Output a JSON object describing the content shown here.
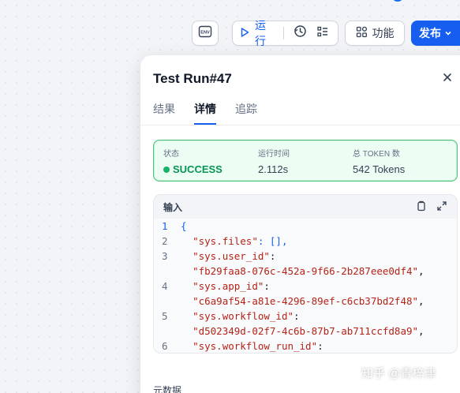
{
  "toolbar": {
    "env_label": "ENV",
    "run_label": "运行",
    "features_label": "功能",
    "publish_label": "发布"
  },
  "panel": {
    "title": "Test Run#47",
    "tabs": [
      {
        "label": "结果",
        "active": false
      },
      {
        "label": "详情",
        "active": true
      },
      {
        "label": "追踪",
        "active": false
      }
    ],
    "status": {
      "status_label": "状态",
      "status_value": "SUCCESS",
      "time_label": "运行时间",
      "time_value": "2.112s",
      "tokens_label": "总 TOKEN 数",
      "tokens_value": "542 Tokens"
    },
    "input": {
      "title": "输入",
      "lines": [
        {
          "num": "1",
          "text": "{"
        },
        {
          "num": "2",
          "text": "  \"sys.files\": [],"
        },
        {
          "num": "3",
          "text": "  \"sys.user_id\":"
        },
        {
          "num": "",
          "text": "  \"fb29faa8-076c-452a-9f66-2b287eee0df4\","
        },
        {
          "num": "4",
          "text": "  \"sys.app_id\":"
        },
        {
          "num": "",
          "text": "  \"c6a9af54-a81e-4296-89ef-c6cb37bd2f48\","
        },
        {
          "num": "5",
          "text": "  \"sys.workflow_id\":"
        },
        {
          "num": "",
          "text": "  \"d502349d-02f7-4c6b-87b7-ab711ccfd8a9\","
        },
        {
          "num": "6",
          "text": "  \"sys.workflow_run_id\":"
        }
      ]
    },
    "metadata_label": "元数据"
  },
  "watermark": "知乎 @青梓津",
  "colors": {
    "accent": "#155eef",
    "success": "#079455",
    "success_bg": "#ecfdf3"
  }
}
